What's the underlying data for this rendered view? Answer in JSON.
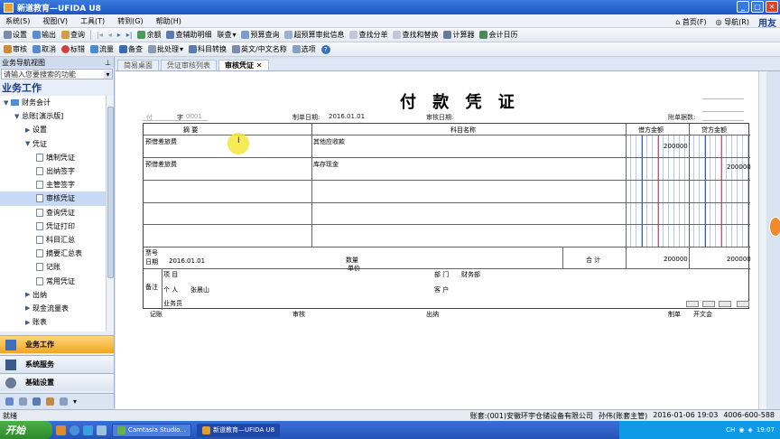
{
  "window": {
    "title": "新道教育—UFIDA U8",
    "min": "_",
    "max": "□",
    "close": "✕"
  },
  "menu": {
    "items": [
      "系统(S)",
      "视图(V)",
      "工具(T)",
      "转到(G)",
      "帮助(H)"
    ],
    "home": "首页(F)",
    "nav": "导航(R)",
    "logo": "用友"
  },
  "toolbar1": [
    "设置",
    "输出",
    "查询",
    "余额",
    "查辅助明细",
    "联查",
    "预算查询",
    "超预算审批信息",
    "查找分单",
    "查找和替换",
    "计算器",
    "会计日历"
  ],
  "toolbar2": [
    "审核",
    "取消",
    "标错",
    "流量",
    "备查",
    "批处理",
    "科目转换",
    "英文/中文名称",
    "选项"
  ],
  "sidebar": {
    "header": "业务导航视图",
    "search_placeholder": "请输入您要搜索的功能",
    "title": "业务工作",
    "tree": [
      {
        "label": "财务会计",
        "level": 0,
        "kind": "folder"
      },
      {
        "label": "总账[演示版]",
        "level": 1,
        "kind": "folder"
      },
      {
        "label": "设置",
        "level": 2,
        "kind": "folder"
      },
      {
        "label": "凭证",
        "level": 2,
        "kind": "folder"
      },
      {
        "label": "填制凭证",
        "level": 3,
        "kind": "doc"
      },
      {
        "label": "出纳签字",
        "level": 3,
        "kind": "doc"
      },
      {
        "label": "主管签字",
        "level": 3,
        "kind": "doc"
      },
      {
        "label": "审核凭证",
        "level": 3,
        "kind": "doc",
        "selected": true
      },
      {
        "label": "查询凭证",
        "level": 3,
        "kind": "doc"
      },
      {
        "label": "凭证打印",
        "level": 3,
        "kind": "doc"
      },
      {
        "label": "科目汇总",
        "level": 3,
        "kind": "doc"
      },
      {
        "label": "摘要汇总表",
        "level": 3,
        "kind": "doc"
      },
      {
        "label": "记账",
        "level": 3,
        "kind": "doc"
      },
      {
        "label": "常用凭证",
        "level": 3,
        "kind": "doc"
      },
      {
        "label": "出纳",
        "level": 2,
        "kind": "folder"
      },
      {
        "label": "现金流量表",
        "level": 2,
        "kind": "folder"
      },
      {
        "label": "账表",
        "level": 2,
        "kind": "folder"
      }
    ],
    "nav": [
      "业务工作",
      "系统服务",
      "基础设置"
    ]
  },
  "tabs": [
    "简易桌面",
    "凭证审核列表",
    "审核凭证"
  ],
  "voucher": {
    "title": "付 款 凭 证",
    "word_label": "付",
    "word_suffix": "字",
    "number": "0001",
    "make_date_label": "制单日期:",
    "make_date": "2016.01.01",
    "audit_date_label": "审核日期:",
    "attachments_label": "附单据数:",
    "col_summary": "摘 要",
    "col_account": "科目名称",
    "col_debit": "借方金额",
    "col_credit": "贷方金额",
    "rows": [
      {
        "summary": "预借差旅费",
        "account": "其他应收款",
        "debit": "200000",
        "credit": ""
      },
      {
        "summary": "预借差旅费",
        "account": "库存现金",
        "debit": "",
        "credit": "200000"
      }
    ],
    "ticket_label": "票号",
    "date_label": "日期",
    "ticket_date": "2016.01.01",
    "qty_label": "数量",
    "price_label": "单价",
    "total_label": "合 计",
    "total_debit": "200000",
    "total_credit": "200000",
    "remark_label": "备注",
    "project_label": "项 目",
    "dept_label": "部 门",
    "dept_value": "财务部",
    "person_label": "个 人",
    "person_value": "张晨山",
    "customer_label": "客 户",
    "staff_label": "业务员",
    "bookkeep": "记账",
    "audit": "审核",
    "cashier": "出纳",
    "maker": "制单",
    "maker_name": "开文会"
  },
  "status": {
    "left": "就绪",
    "account": "账套:(001)安徽环宇仓储设备有限公司",
    "user": "孙伟(账套主管)",
    "datetime": "2016-01-06 19:03",
    "phone": "4006-600-588"
  },
  "taskbar": {
    "start": "开始",
    "tasks": [
      "Camtasia Studio...",
      "新道教育—UFIDA U8"
    ],
    "clock": "19:07",
    "lang": "CH"
  }
}
